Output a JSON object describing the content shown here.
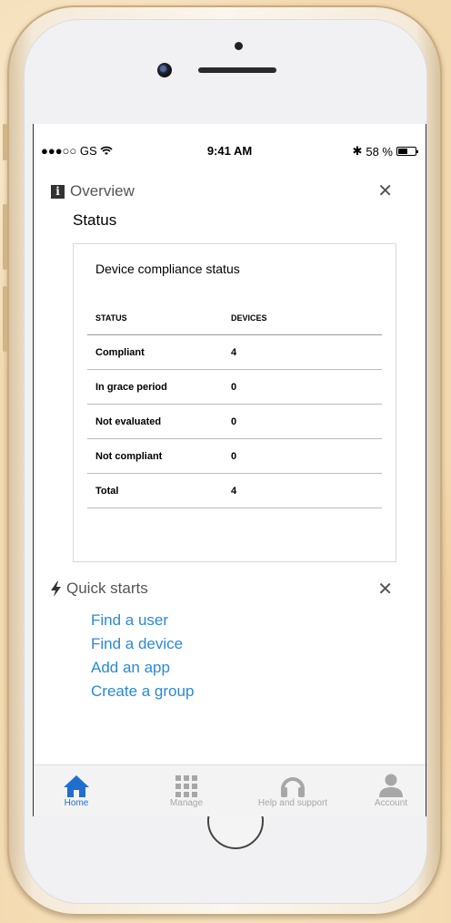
{
  "status_bar": {
    "carrier": "●●●○○ GS",
    "time": "9:41 AM",
    "battery_percent": "58 %",
    "battery_level": 0.58
  },
  "overview": {
    "header": "Overview",
    "subtitle": "Status"
  },
  "compliance_card": {
    "title": "Device compliance status",
    "columns": [
      "STATUS",
      "DEVICES"
    ],
    "rows": [
      {
        "status": "Compliant",
        "devices": "4"
      },
      {
        "status": "In grace period",
        "devices": "0"
      },
      {
        "status": "Not evaluated",
        "devices": "0"
      },
      {
        "status": "Not compliant",
        "devices": "0"
      },
      {
        "status": "Total",
        "devices": "4"
      }
    ]
  },
  "quick_starts": {
    "header": "Quick starts",
    "links": [
      "Find a user",
      "Find a device",
      "Add an app",
      "Create a group"
    ]
  },
  "tabbar": {
    "tabs": [
      {
        "label": "Home",
        "icon": "home-icon",
        "active": true
      },
      {
        "label": "Manage",
        "icon": "grid-icon",
        "active": false
      },
      {
        "label": "Help and support",
        "icon": "headset-icon",
        "active": false
      },
      {
        "label": "Account",
        "icon": "person-icon",
        "active": false
      }
    ],
    "active_color": "#1e6fd0",
    "inactive_color": "#a7a7a7"
  },
  "colors": {
    "link": "#2b88d8",
    "background": "#ffffff"
  }
}
